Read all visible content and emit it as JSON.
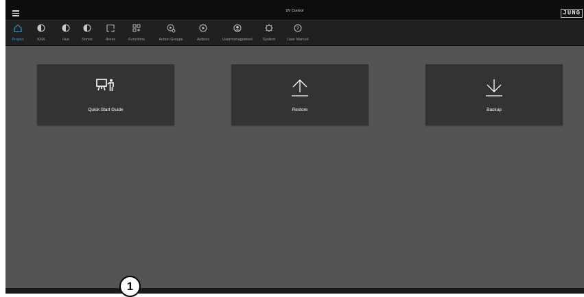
{
  "app": {
    "title": "SV Control",
    "logo_text": "JUNG",
    "accent_color": "#2d9ee0"
  },
  "nav": [
    {
      "label": "Project",
      "icon": "home-icon",
      "active": true
    },
    {
      "label": "KNX",
      "icon": "half-circle-icon"
    },
    {
      "label": "Hue",
      "icon": "half-circle-icon"
    },
    {
      "label": "Sonos",
      "icon": "half-circle-icon"
    },
    {
      "label": "Areas",
      "icon": "areas-icon"
    },
    {
      "label": "Functions",
      "icon": "functions-grid-icon"
    },
    {
      "label": "Action Groups",
      "icon": "action-groups-icon"
    },
    {
      "label": "Actions",
      "icon": "play-circle-icon"
    },
    {
      "label": "Usermanagement",
      "icon": "user-circle-icon"
    },
    {
      "label": "System",
      "icon": "system-gear-icon"
    },
    {
      "label": "User Manual",
      "icon": "help-circle-icon"
    }
  ],
  "tiles": [
    {
      "label": "Quick Start Guide",
      "icon": "presentation-icon"
    },
    {
      "label": "Restore",
      "icon": "upload-arrow-icon"
    },
    {
      "label": "Backup",
      "icon": "download-arrow-icon"
    }
  ],
  "marker": {
    "label": "1"
  }
}
